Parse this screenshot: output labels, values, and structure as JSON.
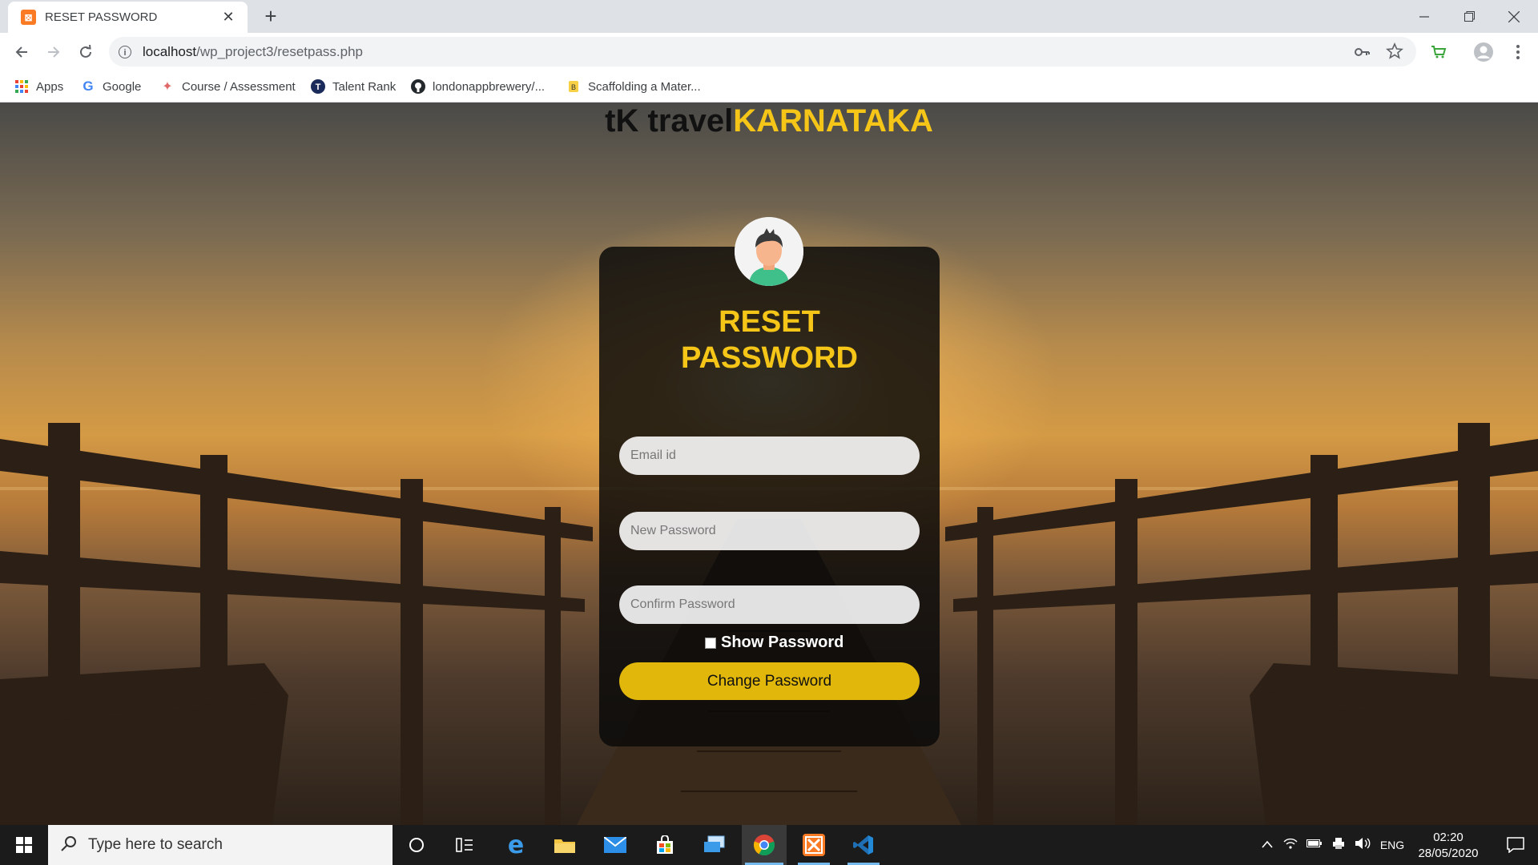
{
  "browser": {
    "tab": {
      "title": "RESET PASSWORD",
      "favicon": "xampp-icon"
    },
    "url": {
      "host": "localhost",
      "path": "/wp_project3/resetpass.php"
    },
    "bookmarks": [
      {
        "label": "Apps",
        "icon": "apps-grid-icon"
      },
      {
        "label": "Google",
        "icon": "google-icon"
      },
      {
        "label": "Course / Assessment",
        "icon": "course-icon"
      },
      {
        "label": "Talent Rank",
        "icon": "talent-rank-icon"
      },
      {
        "label": "londonappbrewery/...",
        "icon": "github-icon"
      },
      {
        "label": "Scaffolding a Mater...",
        "icon": "scaffolding-icon"
      }
    ]
  },
  "site": {
    "logo_part1": "tK travel",
    "logo_part2": "KARNATAKA"
  },
  "form": {
    "title_line1": "RESET",
    "title_line2": "PASSWORD",
    "email_placeholder": "Email id",
    "new_password_placeholder": "New Password",
    "confirm_password_placeholder": "Confirm Password",
    "show_password_label": "Show Password",
    "show_password_checked": false,
    "submit_label": "Change Password"
  },
  "taskbar": {
    "search_placeholder": "Type here to search",
    "language": "ENG",
    "time": "02:20",
    "date": "28/05/2020"
  },
  "colors": {
    "accent": "#f5c518",
    "button": "#e0b70a",
    "card": "#0a0a0a"
  }
}
